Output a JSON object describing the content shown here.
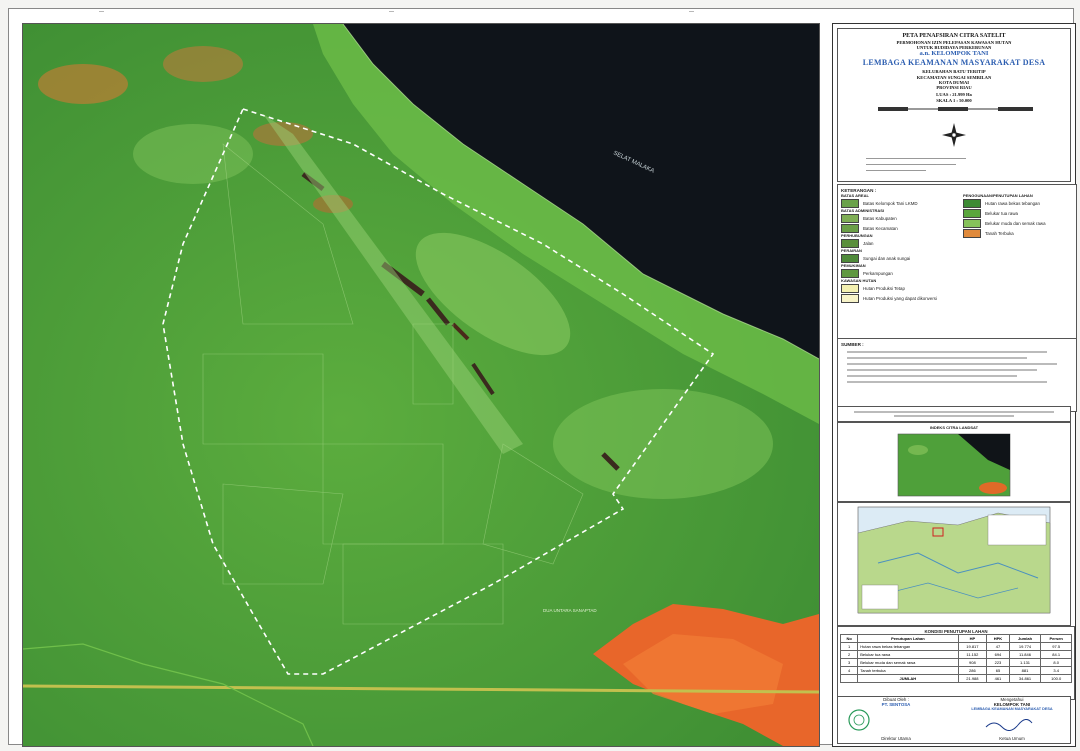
{
  "title": {
    "line1": "PETA PENAFSIRAN CITRA SATELIT",
    "line2": "PERMOHONAN IZIN PELEPASAN KAWASAN HUTAN",
    "line3": "UNTUK BUDIDAYA PERKEBUNAN",
    "line4": "a.n. KELOMPOK TANI",
    "line5": "LEMBAGA KEAMANAN MASYARAKAT DESA",
    "line6": "KELURAHAN BATU TERITIP",
    "line7": "KECAMATAN SUNGAI SEMBILAN",
    "line8": "KOTA DUMAI",
    "line9": "PROVINSI RIAU",
    "line10": "LUAS : 21.999 Ha",
    "line11": "SKALA 1 : 50.000"
  },
  "map": {
    "sea_label": "SELAT MALAKA",
    "area_label": "DUA UNTARA SANAPTAD"
  },
  "legend": {
    "heading": "KETERANGAN :",
    "left_groups": [
      {
        "title": "BATAS AREAL",
        "items": [
          {
            "label": "Batas Kelompok Tani LKMD",
            "color": "#6aa24a"
          }
        ]
      },
      {
        "title": "BATAS ADMINISTRASI",
        "items": [
          {
            "label": "Batas Kabupaten",
            "color": "#7fae55"
          },
          {
            "label": "Batas Kecamatan",
            "color": "#6b9f47"
          }
        ]
      },
      {
        "title": "PERHUBUNGAN",
        "items": [
          {
            "label": "Jalan",
            "color": "#5a8f3c"
          }
        ]
      },
      {
        "title": "PERAIRAN",
        "items": [
          {
            "label": "Sungai dan anak sungai",
            "color": "#4f8a3a"
          }
        ]
      },
      {
        "title": "PEMUKIMAN",
        "items": [
          {
            "label": "Perkampungan",
            "color": "#5f9840"
          }
        ]
      },
      {
        "title": "KAWASAN HUTAN",
        "items": [
          {
            "label": "Hutan Produksi Tetap",
            "color": "#f3f0b0"
          },
          {
            "label": "Hutan Produksi yang dapat dikonversi",
            "color": "#f7f3c8"
          }
        ]
      }
    ],
    "right_title": "PENGGUNAAN/PENUTUPAN LAHAN",
    "right_items": [
      {
        "label": "Hutan rawa bekas tebangan",
        "color": "#3d8b34"
      },
      {
        "label": "Belukar tua rawa",
        "color": "#5aa63c"
      },
      {
        "label": "Belukar muda dan semak rawa",
        "color": "#86c25a"
      },
      {
        "label": "Tanah Terbuka",
        "color": "#e08a3c"
      }
    ]
  },
  "source": {
    "heading": "SUMBER :"
  },
  "inset1_title": "INDEKS CITRA LANDSAT",
  "table": {
    "title": "KONDISI PENUTUPAN LAHAN",
    "headers": [
      "No",
      "Penutupan Lahan",
      "HP",
      "HPK",
      "Jumlah",
      "Persen"
    ],
    "rows": [
      [
        "1",
        "Hutan rawa bekas tebangan",
        "19.817",
        "47",
        "19.774",
        "97.5"
      ],
      [
        "2",
        "Belukar tua rawa",
        "11.152",
        "694",
        "11.846",
        "84.1"
      ],
      [
        "3",
        "Belukar muda dan semak rawa",
        "908",
        "223",
        "1.131",
        "8.0"
      ],
      [
        "4",
        "Tanah terbuka",
        "286",
        "65",
        "881",
        "3.4"
      ]
    ],
    "total": [
      "",
      "JUMLAH",
      "21.988",
      "461",
      "34.861",
      "100.0"
    ]
  },
  "signature": {
    "left_title": "Dibuat Oleh :",
    "left_company": "PT. SENTOSA",
    "left_role": "Direktur Utama",
    "right_title": "Mengetahui",
    "right_org1": "KELOMPOK TANI",
    "right_org2": "LEMBAGA KEAMANAN MASYARAKAT DESA",
    "right_role": "Ketua Umum"
  },
  "colors": {
    "vegetation": "#4fa03a",
    "sea": "#101418",
    "bare_land": "#e06a28",
    "boundary": "#ffffff",
    "title_blue": "#2b5db0"
  }
}
